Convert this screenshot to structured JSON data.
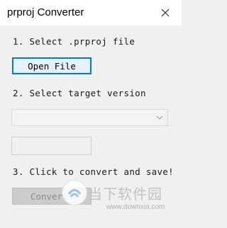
{
  "window": {
    "title": "prproj Converter",
    "close_icon": "close-icon"
  },
  "step1": {
    "label": "1. Select .prproj file",
    "open_button_label": "Open File"
  },
  "step2": {
    "label": "2. Select target version",
    "version_select_value": "",
    "version_text_value": ""
  },
  "step3": {
    "label": "3. Click to convert and save!",
    "convert_button_label": "Convert!"
  },
  "watermark": {
    "brand_cn": "当下软件园",
    "url": "www.downxia.com"
  },
  "colors": {
    "accent": "#0078d7",
    "window_bg": "#f0f0f0",
    "titlebar_bg": "#ffffff"
  }
}
